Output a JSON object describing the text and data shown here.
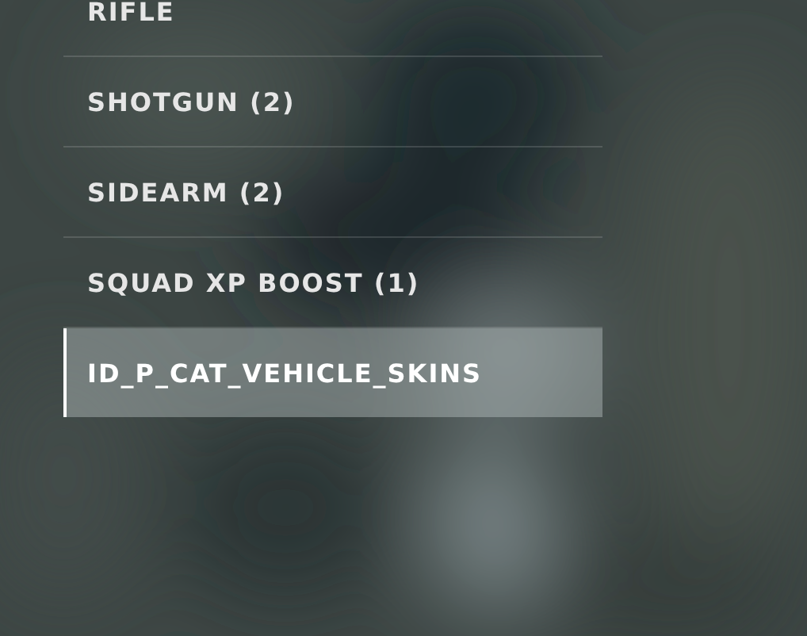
{
  "categories": [
    {
      "label": "RIFLE",
      "selected": false
    },
    {
      "label": "SHOTGUN (2)",
      "selected": false
    },
    {
      "label": "SIDEARM (2)",
      "selected": false
    },
    {
      "label": "SQUAD XP BOOST (1)",
      "selected": false
    },
    {
      "label": "ID_P_CAT_VEHICLE_SKINS",
      "selected": true
    }
  ]
}
